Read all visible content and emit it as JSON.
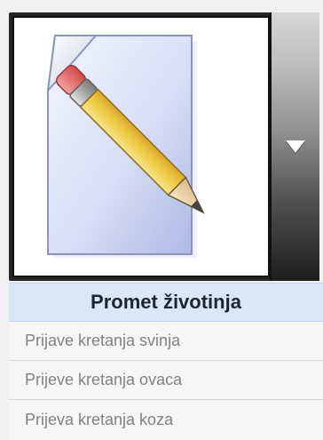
{
  "widget": {
    "icon": "document-edit-icon",
    "dropdown_icon": "chevron-down-icon"
  },
  "menu": {
    "title": "Promet životinja",
    "items": [
      {
        "label": "Prijave kretanja svinja"
      },
      {
        "label": "Prijeve kretanja ovaca"
      },
      {
        "label": "Prijeva kretanja koza"
      }
    ]
  },
  "colors": {
    "header_bg": "#d9e7f6",
    "item_text": "#828282",
    "page_bg": "#f1f1f1"
  }
}
